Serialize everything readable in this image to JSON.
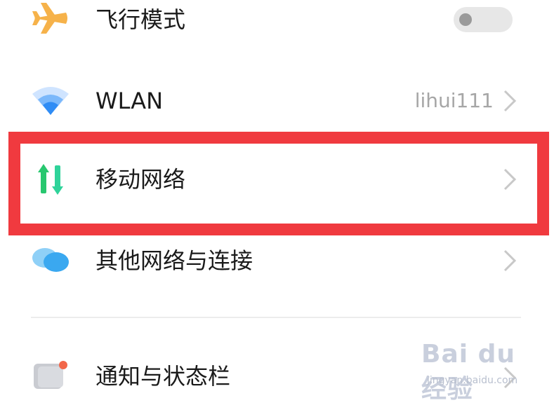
{
  "settings": {
    "airplane": {
      "label": "飞行模式",
      "toggle_on": false
    },
    "wlan": {
      "label": "WLAN",
      "value": "lihui111"
    },
    "mobile": {
      "label": "移动网络"
    },
    "other": {
      "label": "其他网络与连接"
    },
    "notify": {
      "label": "通知与状态栏"
    }
  },
  "watermark": {
    "brand": "Bai du 经验",
    "url": "jingyan.baidu.com"
  },
  "colors": {
    "highlight": "#f03a3f",
    "airplane": "#f6b24a",
    "wifi": "#2f8cf5",
    "mobile_green": "#28c76f",
    "bubble": "#3aa8f0"
  },
  "icons": [
    "airplane-icon",
    "wifi-icon",
    "mobile-data-icon",
    "network-bubbles-icon",
    "notification-icon",
    "chevron-right-icon"
  ]
}
